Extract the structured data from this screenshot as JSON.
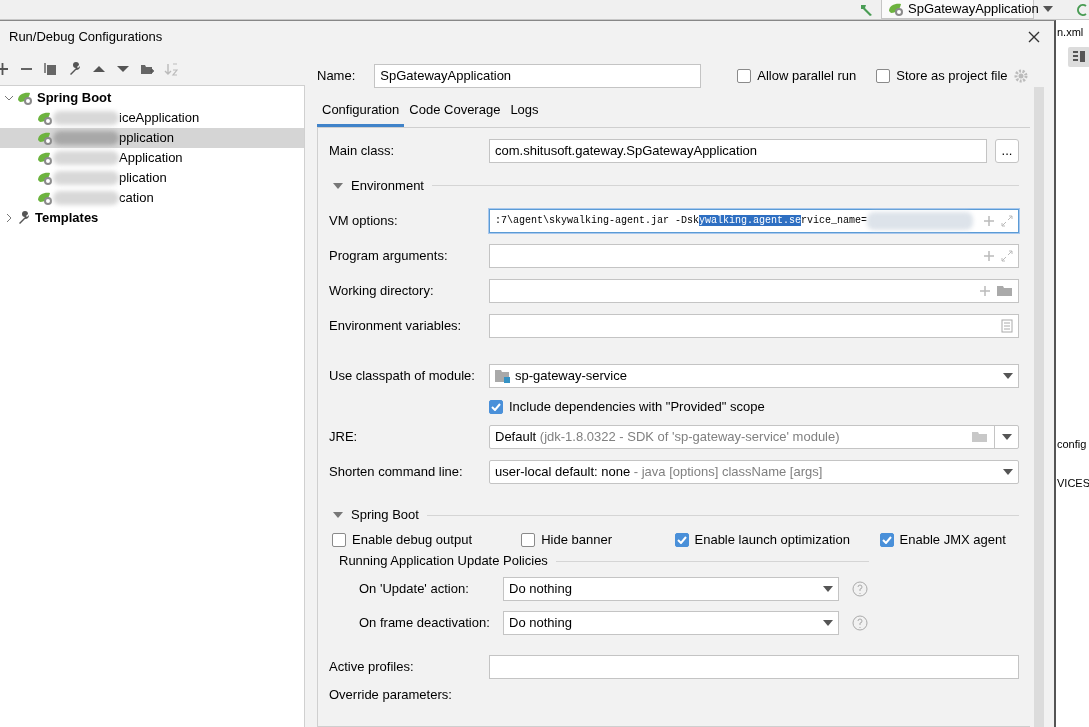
{
  "ide": {
    "run_config": "SpGatewayApplication",
    "side_texts": [
      "n.xml",
      "config",
      "VICES"
    ]
  },
  "window": {
    "title": "Run/Debug Configurations"
  },
  "tree": [
    {
      "label": "Spring Boot",
      "kind": "group",
      "expanded": true,
      "children": [
        {
          "label": "iceApplication",
          "selected": false
        },
        {
          "label": "pplication",
          "selected": true
        },
        {
          "label": "Application",
          "selected": false
        },
        {
          "label": "plication",
          "selected": false
        },
        {
          "label": "cation",
          "selected": false
        }
      ]
    },
    {
      "label": "Templates",
      "kind": "templates",
      "expanded": false
    }
  ],
  "name": {
    "label": "Name:",
    "value": "SpGatewayApplication"
  },
  "options": [
    {
      "label": "Allow parallel run",
      "checked": false
    },
    {
      "label": "Store as project file",
      "checked": false
    }
  ],
  "tabs": [
    {
      "label": "Configuration",
      "selected": true
    },
    {
      "label": "Code Coverage",
      "selected": false
    },
    {
      "label": "Logs",
      "selected": false
    }
  ],
  "rows": [
    {
      "kind": "class",
      "label": "Main class:",
      "value": "com.shitusoft.gateway.SpGatewayApplication",
      "button": "..."
    },
    {
      "kind": "section",
      "label": "Environment",
      "expanded": true
    },
    {
      "kind": "expandable",
      "label": "VM options:",
      "value": ":7\\agent\\skywalking-agent.jar -Dsk",
      "selection": "ywalking.agent.se",
      "value_after": "rvice_name="
    },
    {
      "kind": "expandable",
      "label": "Program arguments:"
    },
    {
      "kind": "directory",
      "label": "Working directory:"
    },
    {
      "kind": "variables",
      "label": "Environment variables:"
    },
    {
      "kind": "module",
      "label": "Use classpath of module:",
      "value": "sp-gateway-service"
    },
    {
      "kind": "checkbox",
      "label": "Include dependencies with \"Provided\" scope",
      "checked": true
    },
    {
      "kind": "jre",
      "label": "JRE:",
      "value": "Default",
      "hint": "(jdk-1.8.0322 - SDK of 'sp-gateway-service' module)"
    },
    {
      "kind": "select",
      "label": "Shorten command line:",
      "value": "user-local default: none",
      "hint": "- java [options] className [args]"
    },
    {
      "kind": "section",
      "label": "Spring Boot",
      "expanded": true
    },
    {
      "kind": "checks",
      "items": [
        {
          "label": "Enable debug output",
          "checked": false
        },
        {
          "label": "Hide banner",
          "checked": false
        },
        {
          "label": "Enable launch optimization",
          "checked": true
        },
        {
          "label": "Enable JMX agent",
          "checked": true
        }
      ]
    },
    {
      "kind": "subsection",
      "label": "Running Application Update Policies"
    },
    {
      "kind": "policy",
      "label": "On 'Update' action:",
      "value": "Do nothing"
    },
    {
      "kind": "policy",
      "label": "On frame deactivation:",
      "value": "Do nothing"
    },
    {
      "kind": "plain",
      "label": "Active profiles:"
    },
    {
      "kind": "heading",
      "label": "Override parameters:"
    }
  ]
}
